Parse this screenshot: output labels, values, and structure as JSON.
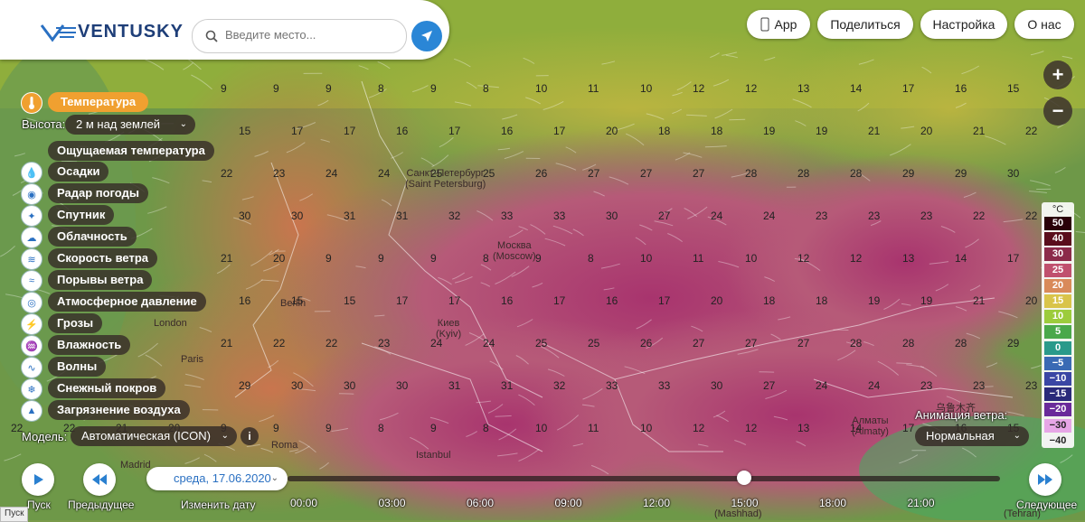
{
  "app": {
    "logo_text": "VENTUSKY"
  },
  "search": {
    "placeholder": "Введите место..."
  },
  "topnav": {
    "app": "App",
    "share": "Поделиться",
    "settings": "Настройка",
    "about": "О нас"
  },
  "zoom": {
    "in": "+",
    "out": "−"
  },
  "layers": {
    "active": "Температура",
    "height_label": "Высота:",
    "height_value": "2 м над землей",
    "feels_like": "Ощущаемая температура",
    "items": [
      "Осадки",
      "Радар погоды",
      "Спутник",
      "Облачность",
      "Скорость ветра",
      "Порывы ветра",
      "Атмосферное давление",
      "Грозы",
      "Влажность",
      "Волны",
      "Снежный покров",
      "Загрязнение воздуха"
    ]
  },
  "model": {
    "label": "Модель:",
    "value": "Автоматическая (ICON)"
  },
  "wind_anim": {
    "label": "Анимация ветра:",
    "value": "Нормальная"
  },
  "date": {
    "value": "среда, 17.06.2020"
  },
  "timeline": {
    "ticks": [
      "00:00",
      "03:00",
      "06:00",
      "09:00",
      "12:00",
      "15:00",
      "18:00",
      "21:00"
    ],
    "current": "15:00"
  },
  "controls": {
    "play": "Пуск",
    "prev": "Предыдущее",
    "change_date": "Изменить дату",
    "next": "Следующее"
  },
  "status": {
    "text": "Пуск"
  },
  "legend": {
    "unit": "°C",
    "values": [
      "50",
      "40",
      "30",
      "25",
      "20",
      "15",
      "10",
      "5",
      "0",
      "−5",
      "−10",
      "−15",
      "−20",
      "−30",
      "−40"
    ],
    "colors": [
      "#2a0008",
      "#5a0d1c",
      "#8c2a4a",
      "#c0506e",
      "#d98a5a",
      "#d9c44a",
      "#9ccc3c",
      "#4aa84a",
      "#2a9a8a",
      "#3a6ab4",
      "#3a46a4",
      "#2a2a7a",
      "#6a2a9a",
      "#e6a6e6",
      "#f2f2f2"
    ]
  },
  "cities": [
    {
      "name": "Санкт-Петербург",
      "sub": "(Saint Petersburg)"
    },
    {
      "name": "Москва",
      "sub": "(Moscow)"
    },
    {
      "name": "Киев",
      "sub": "(Kyiv)"
    },
    {
      "name": "Berlin"
    },
    {
      "name": "London"
    },
    {
      "name": "Paris"
    },
    {
      "name": "Roma"
    },
    {
      "name": "Madrid"
    },
    {
      "name": "Istanbul"
    },
    {
      "name": "Алматы",
      "sub": "(Almaty)"
    },
    {
      "name": "乌鲁木齐"
    },
    {
      "name": "(Tehran)"
    },
    {
      "name": "(Mashhad)"
    }
  ],
  "temps": [
    "9",
    "9",
    "9",
    "8",
    "9",
    "8",
    "10",
    "11",
    "10",
    "12",
    "12",
    "13",
    "14",
    "17",
    "16",
    "15",
    "15",
    "17",
    "17",
    "16",
    "17",
    "16",
    "17",
    "20",
    "18",
    "18",
    "19",
    "19",
    "21",
    "20",
    "21",
    "22",
    "22",
    "23",
    "24",
    "24",
    "25",
    "25",
    "26",
    "27",
    "27",
    "27",
    "28",
    "28",
    "28",
    "29",
    "29",
    "30",
    "30",
    "30",
    "31",
    "31",
    "32",
    "33",
    "33",
    "30",
    "27",
    "24",
    "24",
    "23",
    "23",
    "23",
    "22",
    "22",
    "21",
    "20"
  ]
}
